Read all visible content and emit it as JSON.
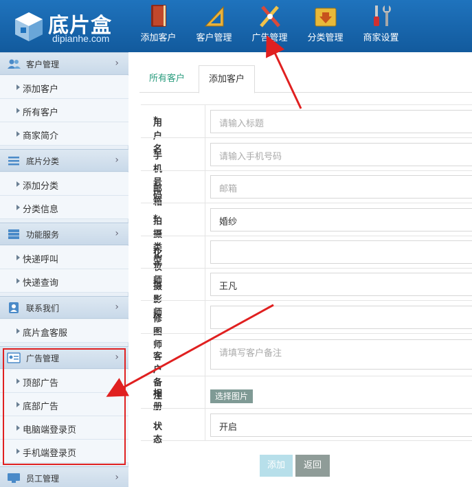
{
  "header": {
    "logo_title": "底片盒",
    "logo_subtitle": "dipianhe.com",
    "nav": [
      {
        "label": "添加客户",
        "icon": "book-icon"
      },
      {
        "label": "客户管理",
        "icon": "ruler-icon"
      },
      {
        "label": "广告管理",
        "icon": "tools-icon"
      },
      {
        "label": "分类管理",
        "icon": "download-folder-icon"
      },
      {
        "label": "商家设置",
        "icon": "wrench-screwdriver-icon"
      }
    ]
  },
  "sidebar": {
    "groups": [
      {
        "label": "客户管理",
        "icon": "users-icon",
        "items": [
          "添加客户",
          "所有客户",
          "商家简介"
        ]
      },
      {
        "label": "底片分类",
        "icon": "list-icon",
        "items": [
          "添加分类",
          "分类信息"
        ]
      },
      {
        "label": "功能服务",
        "icon": "server-icon",
        "items": [
          "快递呼叫",
          "快递查询"
        ]
      },
      {
        "label": "联系我们",
        "icon": "contact-icon",
        "items": [
          "底片盒客服"
        ]
      },
      {
        "label": "广告管理",
        "icon": "id-card-icon",
        "items": [
          "顶部广告",
          "底部广告",
          "电脑端登录页",
          "手机端登录页"
        ]
      },
      {
        "label": "员工管理",
        "icon": "monitor-icon",
        "items": []
      }
    ]
  },
  "tabs": [
    {
      "label": "所有客户"
    },
    {
      "label": "添加客户"
    }
  ],
  "form": {
    "fields": [
      {
        "label": "用户名",
        "required": "*",
        "placeholder": "请输入标题",
        "value": ""
      },
      {
        "label": "手机号码",
        "required": "*",
        "placeholder": "请输入手机号码",
        "value": ""
      },
      {
        "label": "邮箱",
        "required": "*",
        "placeholder": "邮箱",
        "value": ""
      },
      {
        "label": "拍摄类型",
        "required": "*",
        "placeholder": "",
        "value": "婚纱"
      },
      {
        "label": "化妆师",
        "required": "*",
        "placeholder": "",
        "value": ""
      },
      {
        "label": "摄影师",
        "required": "*",
        "placeholder": "",
        "value": "王凡"
      },
      {
        "label": "修图师",
        "required": "*",
        "placeholder": "",
        "value": ""
      },
      {
        "label": "客户备注",
        "required": "",
        "placeholder": "请填写客户备注",
        "value": ""
      },
      {
        "label": "相册",
        "required": "",
        "button": "选择图片"
      },
      {
        "label": "状态",
        "required": "",
        "placeholder": "",
        "value": "开启"
      }
    ],
    "add_label": "添加",
    "back_label": "返回"
  },
  "colors": {
    "header_blue": "#1668b0",
    "tab_active_green": "#2a9c7e",
    "required_red": "#e02020",
    "annotation_red": "#e02020"
  }
}
